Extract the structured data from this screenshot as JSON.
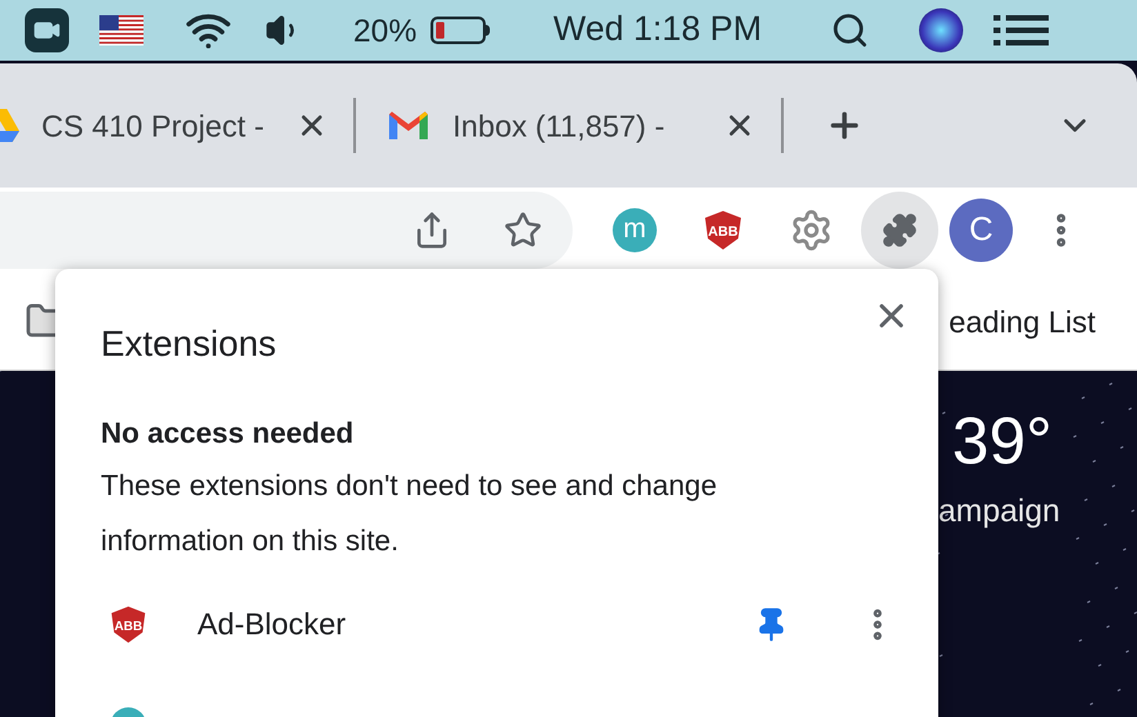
{
  "menu_bar": {
    "battery_percent": "20%",
    "battery": {
      "level": 0.2
    },
    "clock": "Wed 1:18 PM"
  },
  "tabs": [
    {
      "title": "CS 410 Project -",
      "kind": "drive",
      "selected": false
    },
    {
      "title": "Inbox (11,857) -",
      "kind": "mail",
      "selected": false
    }
  ],
  "toolbar": {
    "extensions": [
      {
        "kind": "letter",
        "text": "m",
        "active": false
      },
      {
        "kind": "shield",
        "text": "ABB",
        "active": false
      },
      {
        "kind": "gear",
        "active": false
      },
      {
        "kind": "puzzle",
        "active": true
      }
    ],
    "profile": "C"
  },
  "bookmarks_bar": {
    "reading_list": "eading List"
  },
  "weather": {
    "temperature": "39°",
    "location": "ampaign"
  },
  "popup": {
    "title": "Extensions",
    "section_title": "No access needed",
    "section_text": "These extensions don't need to see and change information on this site.",
    "items": [
      {
        "name": "Ad-Blocker",
        "icon_text": "ABB",
        "pinned": true
      }
    ]
  }
}
